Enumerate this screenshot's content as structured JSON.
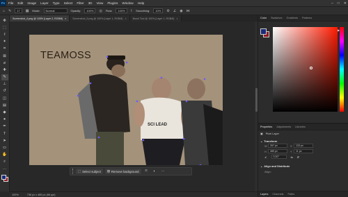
{
  "menubar": {
    "app_logo": "Ps",
    "items": [
      "File",
      "Edit",
      "Image",
      "Layer",
      "Type",
      "Select",
      "Filter",
      "3D",
      "View",
      "Plugins",
      "Window",
      "Help"
    ],
    "window_controls": [
      "–",
      "□",
      "✕"
    ]
  },
  "options": {
    "mode_label": "Mode:",
    "mode_value": "Normal",
    "opacity_label": "Opacity:",
    "opacity_value": "100%",
    "flow_label": "Flow:",
    "flow_value": "100%",
    "smoothing_label": "Smoothing:",
    "smoothing_value": "10%",
    "brush_size": "17"
  },
  "tabs": [
    {
      "label": "Screenshot_4.png @ 100% (Layer 2, RGB/8)",
      "active": true
    },
    {
      "label": "Screenshot_5.png @ 100% (Layer 1, RGB/8)",
      "active": false
    },
    {
      "label": "Brush Tool @ 100% (Layer 1, RGB/8)",
      "active": false
    }
  ],
  "canvas": {
    "overlay_text": "TEAMOSS",
    "shirt_text": "SCI LEAD"
  },
  "context_bar": {
    "select_subject_label": "Select subject",
    "remove_background_label": "Remove background",
    "more_label": "···"
  },
  "status": {
    "zoom": "100%",
    "doc_info": "736 px x 485 px (96 ppi)"
  },
  "right_panel": {
    "color_tabs": [
      "Color",
      "Swatches",
      "Gradients",
      "Patterns"
    ],
    "properties_tabs": [
      "Properties",
      "Adjustments",
      "Libraries"
    ],
    "layer_type": "Pixel Layer",
    "transform_title": "Transform",
    "w_label": "W",
    "w_value": "267 px",
    "x_label": "X",
    "x_value": "133 px",
    "h_label": "H",
    "h_value": "485 px",
    "y_label": "Y",
    "y_value": "11 px",
    "angle_value": "0.00°",
    "align_title": "Align and Distribute",
    "align_sub": "Align:",
    "bottom_tabs": [
      "Layers",
      "Channels",
      "Paths"
    ]
  },
  "colors": {
    "foreground": "#1c2a7a",
    "background": "#8e1b24",
    "accent": "#31a8ff"
  }
}
